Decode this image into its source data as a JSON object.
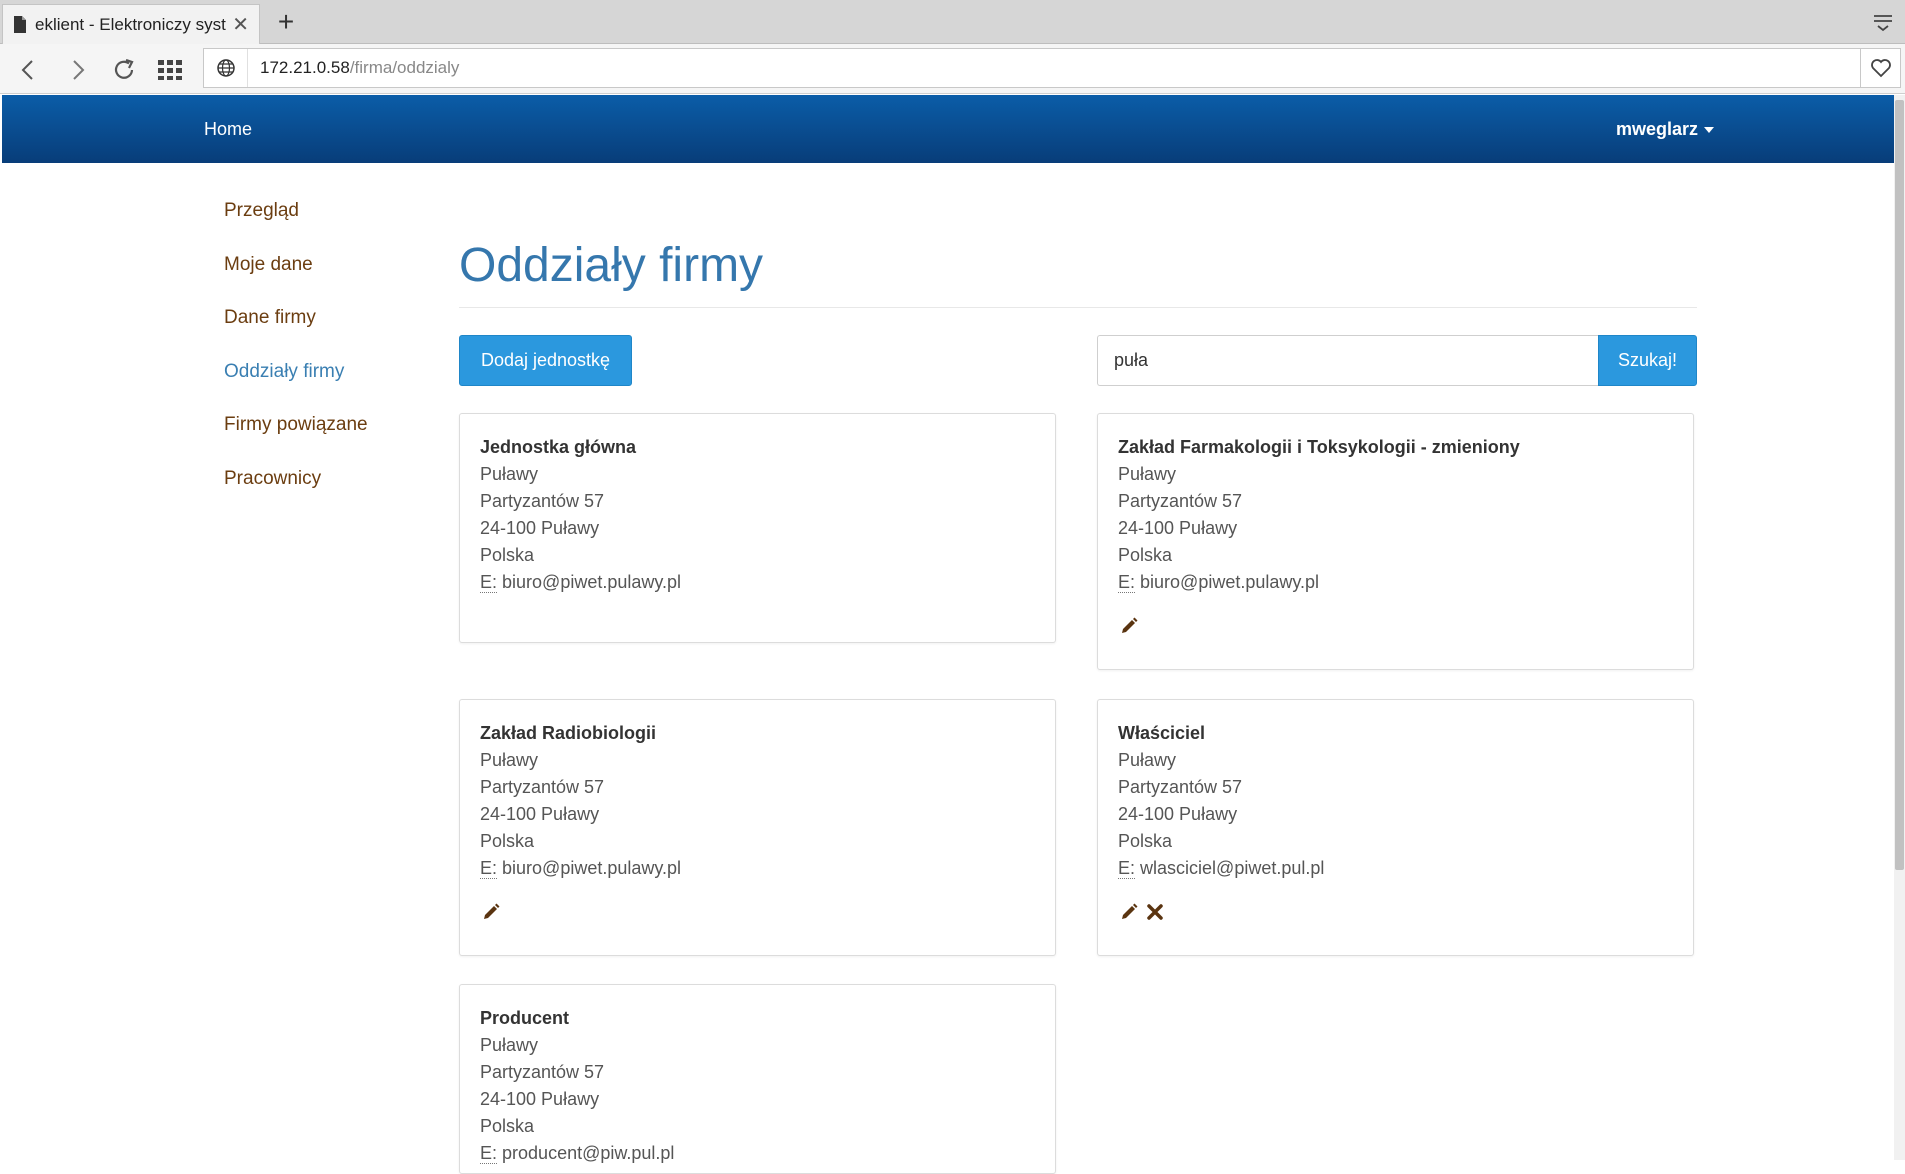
{
  "browser": {
    "tab_title": "eklient - Elektroniczy syste",
    "url_host": "172.21.0.58",
    "url_path": "/firma/oddzialy"
  },
  "header": {
    "brand": "Home",
    "user": "mweglarz"
  },
  "sidebar": {
    "items": [
      {
        "label": "Przegląd"
      },
      {
        "label": "Moje dane"
      },
      {
        "label": "Dane firmy"
      },
      {
        "label": "Oddziały firmy",
        "active": true
      },
      {
        "label": "Firmy powiązane"
      },
      {
        "label": "Pracownicy"
      }
    ]
  },
  "main": {
    "title": "Oddziały firmy",
    "add_button": "Dodaj jednostkę",
    "search_value": "puła",
    "search_button": "Szukaj!",
    "email_prefix": "E:",
    "cards": [
      {
        "name": "Jednostka główna",
        "city": "Puławy",
        "street": "Partyzantów 57",
        "postal": "24-100 Puławy",
        "country": "Polska",
        "email": "biuro@piwet.pulawy.pl",
        "actions": []
      },
      {
        "name": "Zakład Farmakologii i Toksykologii - zmieniony",
        "city": "Puławy",
        "street": "Partyzantów 57",
        "postal": "24-100 Puławy",
        "country": "Polska",
        "email": "biuro@piwet.pulawy.pl",
        "actions": [
          "pencil-icon"
        ]
      },
      {
        "name": "Zakład Radiobiologii",
        "city": "Puławy",
        "street": "Partyzantów 57",
        "postal": "24-100 Puławy",
        "country": "Polska",
        "email": "biuro@piwet.pulawy.pl",
        "actions": [
          "pencil-icon"
        ]
      },
      {
        "name": "Właściciel",
        "city": "Puławy",
        "street": "Partyzantów 57",
        "postal": "24-100 Puławy",
        "country": "Polska",
        "email": "wlasciciel@piwet.pul.pl",
        "actions": [
          "pencil-icon",
          "close-icon"
        ]
      },
      {
        "name": "Producent",
        "city": "Puławy",
        "street": "Partyzantów 57",
        "postal": "24-100 Puławy",
        "country": "Polska",
        "email": "producent@piw.pul.pl",
        "actions": []
      }
    ]
  },
  "colors": {
    "header_top": "#0b5da8",
    "header_bottom": "#083d79",
    "accent_blue": "#2b98de",
    "title_blue": "#3577ad",
    "sidebar_link": "#6b3d10",
    "icon_brown": "#5a3410"
  }
}
